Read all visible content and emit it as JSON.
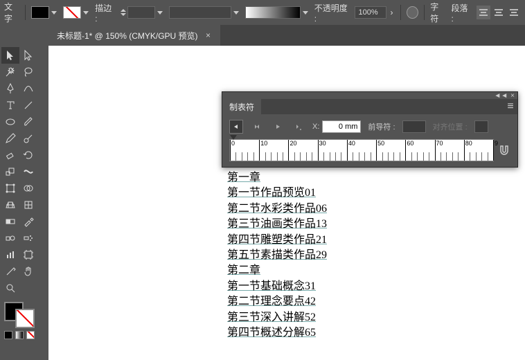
{
  "options_bar": {
    "tool_label": "文字",
    "stroke_label": "描边 :",
    "stroke_value": "",
    "opacity_label": "不透明度 :",
    "opacity_value": "100%",
    "char_label": "字符",
    "para_label": "段落 :"
  },
  "tab": {
    "title": "未标题-1* @ 150% (CMYK/GPU 预览)",
    "close": "×"
  },
  "panel": {
    "title": "制表符",
    "collapse": "◄◄",
    "close": "×",
    "menu": "≡",
    "x_label": "X:",
    "x_value": "0 mm",
    "leader_label": "前导符 :",
    "align_label": "对齐位置 :",
    "ruler_labels": [
      "0",
      "10",
      "20",
      "30",
      "40",
      "50",
      "60",
      "70",
      "80",
      "9"
    ]
  },
  "text_lines": [
    "第一章",
    "第一节作品预览01",
    "第二节水彩类作品06",
    "第三节油画类作品13",
    "第四节雕塑类作品21",
    "第五节素描类作品29",
    "第二章",
    "第一节基础概念31",
    "第二节理念要点42",
    "第三节深入讲解52",
    "第四节概述分解65"
  ],
  "tools": [
    "selection",
    "direct-selection",
    "magic-wand",
    "lasso",
    "pen",
    "curvature",
    "type",
    "line-segment",
    "ellipse",
    "paintbrush",
    "pencil",
    "blob-brush",
    "eraser",
    "rotate",
    "scale",
    "width",
    "free-transform",
    "shape-builder",
    "perspective",
    "mesh",
    "gradient",
    "eyedropper",
    "blend",
    "symbol-sprayer",
    "column-graph",
    "artboard",
    "slice",
    "hand",
    "zoom",
    "fill-stroke"
  ]
}
